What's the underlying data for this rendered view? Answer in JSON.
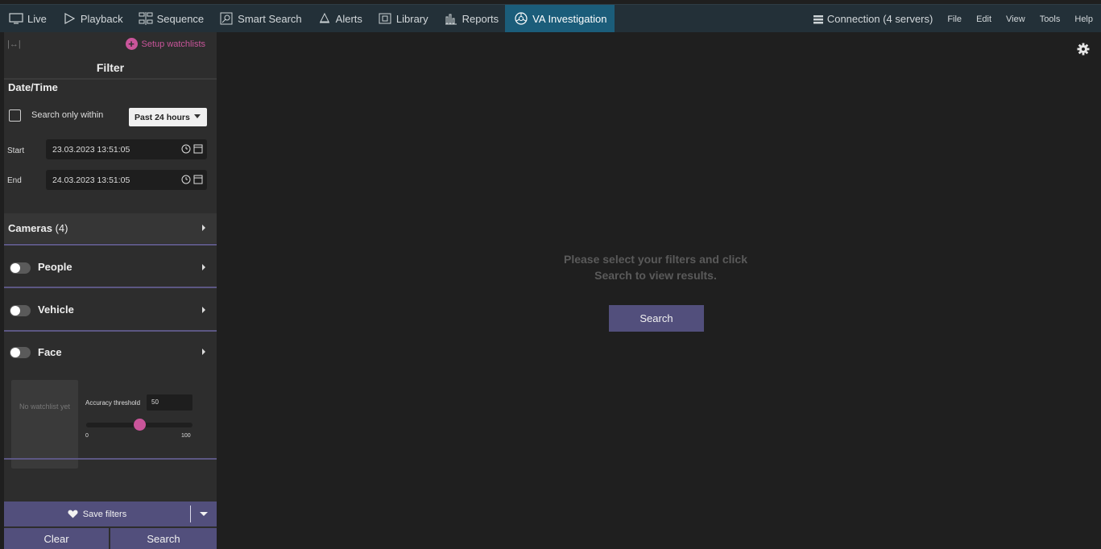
{
  "nav": {
    "items": [
      {
        "label": "Live",
        "icon": "monitor-icon"
      },
      {
        "label": "Playback",
        "icon": "play-icon"
      },
      {
        "label": "Sequence",
        "icon": "sequence-icon"
      },
      {
        "label": "Smart Search",
        "icon": "smart-search-icon"
      },
      {
        "label": "Alerts",
        "icon": "bell-icon"
      },
      {
        "label": "Library",
        "icon": "library-icon"
      },
      {
        "label": "Reports",
        "icon": "reports-icon"
      },
      {
        "label": "VA Investigation",
        "icon": "va-investigation-icon",
        "active": true
      }
    ],
    "connection": "Connection (4 servers)",
    "menus": [
      "File",
      "Edit",
      "View",
      "Tools",
      "Help"
    ]
  },
  "sidebar": {
    "expand_label": "|↔|",
    "setup_watchlists": "Setup watchlists",
    "filter_title": "Filter",
    "datetime": {
      "heading": "Date/Time",
      "search_within_label": "Search only within",
      "range_value": "Past 24 hours",
      "start_label": "Start",
      "start_value": "23.03.2023 13:51:05",
      "end_label": "End",
      "end_value": "24.03.2023 13:51:05"
    },
    "cameras": {
      "label": "Cameras",
      "count": "(4)"
    },
    "people_label": "People",
    "vehicle_label": "Vehicle",
    "face": {
      "label": "Face",
      "no_watchlist": "No watchlist yet",
      "accuracy_label": "Accuracy threshold",
      "accuracy_value": "50",
      "slider_min": "0",
      "slider_max": "100",
      "slider_level": 0.5
    },
    "save_filters": "Save filters",
    "clear_label": "Clear",
    "search_label": "Search"
  },
  "main": {
    "message_line1": "Please select your filters and click",
    "message_line2": "Search to view results.",
    "search_button": "Search"
  },
  "colors": {
    "accent": "#524f7c",
    "highlight": "#c9559a",
    "active_tab": "#1b5d7a"
  }
}
